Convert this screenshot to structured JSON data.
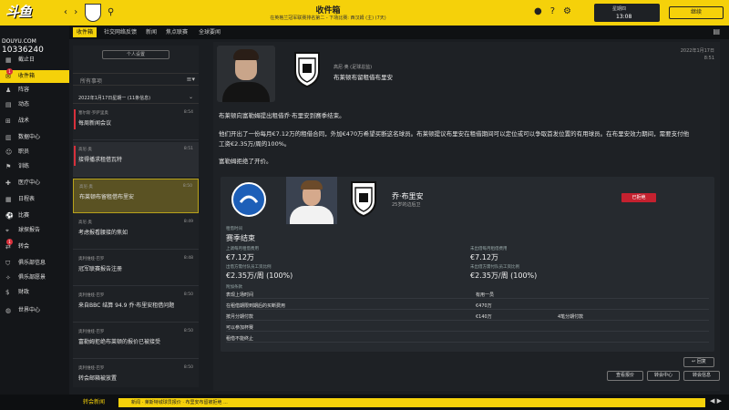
{
  "topbar": {
    "logo": "斗鱼",
    "back": "‹",
    "forward": "›",
    "title": "收件箱",
    "subtitle": "在英格兰冠军联赛排名第二 - 下场比赛: 西汉姆 (主) (7天)",
    "date_line1": "星期四",
    "date_line2": "13:08",
    "continue_label": "继续"
  },
  "sidebar": {
    "watermark": "DOUYU.COM",
    "room": "10336240",
    "items": [
      {
        "label": "截止日",
        "icon": "calendar-icon"
      },
      {
        "label": "收件箱",
        "icon": "mail-icon",
        "active": true,
        "badge": "1"
      },
      {
        "label": "阵容",
        "icon": "shirt-icon"
      },
      {
        "label": "动态",
        "icon": "news-icon"
      },
      {
        "label": "战术",
        "icon": "tactics-icon"
      },
      {
        "label": "数据中心",
        "icon": "chart-icon"
      },
      {
        "label": "职员",
        "icon": "staff-icon"
      },
      {
        "label": "训练",
        "icon": "training-icon"
      },
      {
        "label": "医疗中心",
        "icon": "medical-icon"
      },
      {
        "label": "日程表",
        "icon": "schedule-icon"
      },
      {
        "label": "比赛",
        "icon": "match-icon"
      },
      {
        "label": "球探报告",
        "icon": "scout-icon"
      },
      {
        "label": "转会",
        "icon": "transfer-icon",
        "badge": "1"
      },
      {
        "label": "俱乐部信息",
        "icon": "club-icon"
      },
      {
        "label": "俱乐部愿景",
        "icon": "vision-icon"
      },
      {
        "label": "财政",
        "icon": "finance-icon"
      },
      {
        "label": "世界中心",
        "icon": "world-icon"
      }
    ]
  },
  "tabs": [
    "收件箱",
    "社交网络反馈",
    "新闻",
    "焦点联赛",
    "全球要闻"
  ],
  "inbox": {
    "filter_label": "个人设置",
    "search_placeholder": "所有事项",
    "group_label": "2022年1月17日星期一 (11条信息)",
    "messages": [
      {
        "sender": "塞尔斯·罗萨里奥",
        "subject": "每周新闻会议",
        "time": "8:54",
        "unread": true
      },
      {
        "sender": "高尼·奥",
        "subject": "接得播求租借瓦特",
        "time": "8:51",
        "unread": true,
        "hl": true
      },
      {
        "sender": "高尼·奥",
        "subject": "布莱顿布留租借布里安",
        "time": "8:50",
        "selected": true
      },
      {
        "sender": "高尼·奥",
        "subject": "考虑报看腰接的焦如",
        "time": "8:49"
      },
      {
        "sender": "奥利维娅·巴罗",
        "subject": "冠军联赛报告注册",
        "time": "8:48"
      },
      {
        "sender": "奥利维娅·巴罗",
        "subject": "来自BBC 结算 94.9 乔·布里安租借问题",
        "time": "8:50"
      },
      {
        "sender": "奥利维娅·巴罗",
        "subject": "富勒姆拒绝布莱顿的报价已被接受",
        "time": "8:50"
      },
      {
        "sender": "奥利维娅·巴罗",
        "subject": "转会邮箱被放置",
        "time": "8:50"
      }
    ]
  },
  "detail": {
    "sender_name": "高尼·奥 (足球总监)",
    "headline": "布莱顿布留租借布里安",
    "corner_date": "2022年1月17日",
    "corner_time": "8:51",
    "p1": "布莱顿向富勒姆提出租借乔·布里安到赛季结束。",
    "p2": "他们开出了一份每月€7.12万的租借合同，外加€470万希望买断这名球员。布莱顿提议布里安在租借期间可以定位或可以争取首发位置的有用球员。在布里安效力期间，需要支付他工资€2.35万/周的100%。",
    "p3": "富勒姆拒绝了开价。",
    "card": {
      "player_name": "乔·布里安",
      "player_age": "25岁的边后卫",
      "status_badge": "已拒绝",
      "section_label": "租借时间",
      "duration": "赛季结束",
      "left_fee_label": "上调每月租借费用",
      "left_fee": "€7.12万",
      "right_fee_label": "未出借每月租借费用",
      "right_fee": "€7.12万",
      "left_wage_label": "出借方需付队员工资比例",
      "left_wage": "€2.35万/周 (100%)",
      "right_wage_label": "未出借方需付队员工资比例",
      "right_wage": "€2.35万/周 (100%)",
      "terms_label": "附加条款",
      "terms": [
        {
          "label": "表现上场时间",
          "value": "有用一员",
          "extra": ""
        },
        {
          "label": "在租借期限到期后的买断费用",
          "value": "€470万",
          "extra": ""
        },
        {
          "label": "按月分期付款",
          "value": "€140万",
          "extra": "4笔分期付款"
        },
        {
          "label": "可以参加杯赛",
          "value": "",
          "extra": ""
        },
        {
          "label": "租借不能终止",
          "value": "",
          "extra": ""
        }
      ]
    },
    "reply_label": "回复",
    "buttons": [
      "查看报价",
      "转会中心",
      "转会信息"
    ]
  },
  "ticker": {
    "label": "转会新闻",
    "text": "新闻  · 莱斯特城球员报价 · 布里安布留被拒绝 ..."
  },
  "colors": {
    "accent": "#f5d10a",
    "reject": "#c4212f",
    "unread": "#d8303b"
  }
}
